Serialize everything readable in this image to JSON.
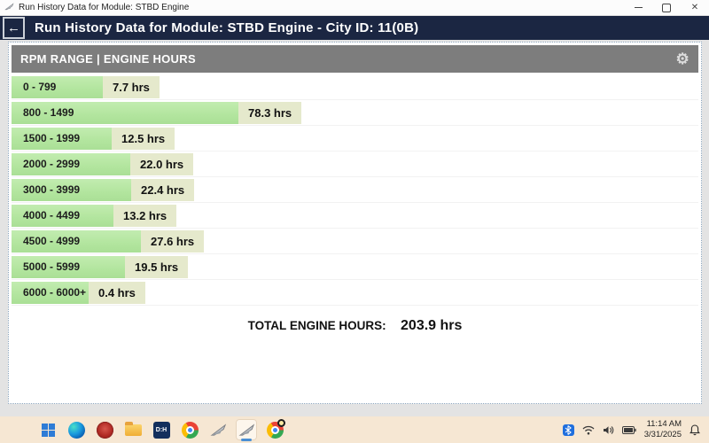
{
  "titlebar": {
    "title": "Run History Data for Module: STBD Engine",
    "window_controls": [
      "minimize",
      "maximize",
      "close"
    ]
  },
  "header": {
    "back_icon": "left-arrow",
    "title": "Run History Data for Module: STBD Engine - City ID: 11(0B)"
  },
  "section": {
    "title": "RPM RANGE | ENGINE HOURS",
    "gear_icon": "⚙"
  },
  "chart_data": {
    "type": "bar",
    "orientation": "horizontal",
    "title": "RPM RANGE | ENGINE HOURS",
    "xlabel": "ENGINE HOURS",
    "ylabel": "RPM RANGE",
    "categories": [
      "0 - 799",
      "800 - 1499",
      "1500 - 1999",
      "2000 - 2999",
      "3000 - 3999",
      "4000 - 4499",
      "4500 - 4999",
      "5000 - 5999",
      "6000 - 6000+"
    ],
    "values": [
      7.7,
      78.3,
      12.5,
      22.0,
      22.4,
      13.2,
      27.6,
      19.5,
      0.4
    ],
    "value_labels": [
      "7.7 hrs",
      "78.3 hrs",
      "12.5 hrs",
      "22.0 hrs",
      "22.4 hrs",
      "13.2 hrs",
      "27.6 hrs",
      "19.5 hrs",
      "0.4 hrs"
    ],
    "unit": "hrs",
    "bar_color": "#b2e59e",
    "value_chip_color": "#e5e9cc",
    "total": 203.9
  },
  "total": {
    "label": "TOTAL ENGINE HOURS:",
    "value": "203.9 hrs"
  },
  "taskbar": {
    "icons": [
      "windows-start",
      "edge-browser",
      "red-app",
      "file-explorer",
      "dh-app",
      "chrome-browser",
      "run-history-app",
      "run-history-app-active",
      "browser-profile"
    ],
    "dh_label": "D:H",
    "tray": {
      "icons": [
        "bluetooth",
        "wifi",
        "volume",
        "battery",
        "bell"
      ],
      "time": "11:14 AM",
      "date": "3/31/2025"
    }
  },
  "colors": {
    "header_navy": "#1b2642",
    "section_gray": "#7d7d7d",
    "bar_green": "#b2e59e",
    "chip_beige": "#e5e9cc",
    "taskbar_beige": "#f6e7d3"
  }
}
